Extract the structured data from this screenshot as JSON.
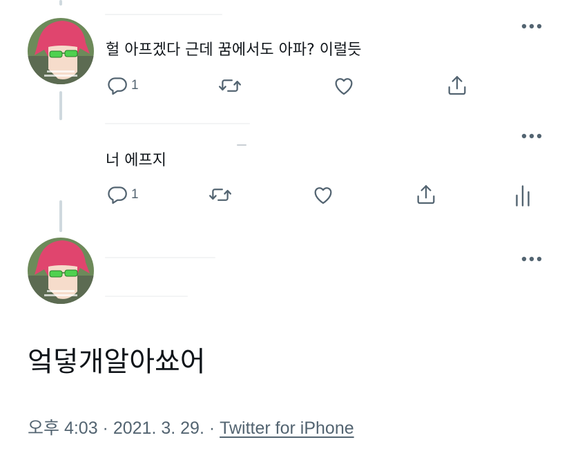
{
  "colors": {
    "text": "#0f1419",
    "secondary": "#536471",
    "thread_line": "#cfd9de",
    "avatar_hair": "#e0456e",
    "avatar_glasses": "#4fd14f"
  },
  "tweets": [
    {
      "text": "헐 아프겠다 근데 꿈에서도 아파? 이럴듯",
      "reply_count": "1",
      "icons": [
        "reply-icon",
        "retweet-icon",
        "like-icon",
        "share-icon",
        "more-icon"
      ]
    },
    {
      "text": "너 에프지",
      "reply_count": "1",
      "icons": [
        "reply-icon",
        "retweet-icon",
        "like-icon",
        "share-icon",
        "analytics-icon",
        "more-icon"
      ]
    }
  ],
  "main_tweet": {
    "text": "엌덯개알아쑈어",
    "time": "오후 4:03",
    "separator": " · ",
    "date": "2021. 3. 29.",
    "separator2": " · ",
    "source": "Twitter for iPhone"
  }
}
